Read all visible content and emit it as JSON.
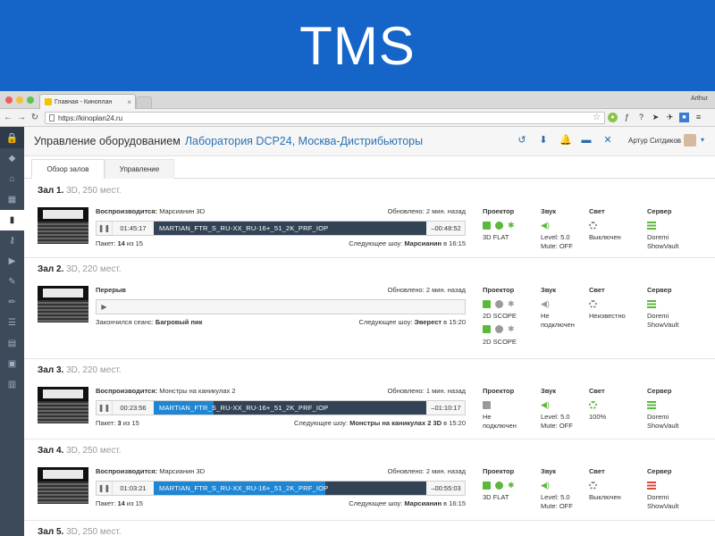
{
  "banner": {
    "title": "TMS"
  },
  "browser": {
    "tab_title": "Главная - Киноплан",
    "user": "Arthur",
    "url": "https://kinoplan24.ru"
  },
  "header": {
    "title": "Управление оборудованием",
    "org_link": "Лаборатория DCP24, Москва-Дистрибьюторы",
    "user_name": "Артур Ситдиков"
  },
  "tabs": {
    "overview": "Обзор залов",
    "control": "Управление"
  },
  "labels": {
    "projector": "Проектор",
    "sound": "Звук",
    "light": "Свет",
    "server": "Сервер"
  },
  "halls": [
    {
      "name": "Зал 1.",
      "meta": "3D, 250 мест.",
      "status_prefix": "Воспроизводится:",
      "status_title": "Марсианин 3D",
      "updated": "Обновлено: 2 мин. назад",
      "elapsed": "01:45:17",
      "track": "MARTIAN_FTR_S_RU-XX_RU-16+_51_2K_PRF_IOP",
      "progress": 0.0,
      "remaining": "–00:48:52",
      "package_prefix": "Пакет:",
      "package_num": "14",
      "package_of": "из 15",
      "next_prefix": "Следующее шоу:",
      "next_title": "Марсианин",
      "next_time": "в 16:15",
      "projector_text": "3D FLAT",
      "sound_text": "Level: 5.0\nMute: OFF",
      "light_text": "Выключен",
      "server_text": "Doremi\nShowVault"
    },
    {
      "name": "Зал 2.",
      "meta": "3D, 220 мест.",
      "status_title": "Перерыв",
      "updated": "Обновлено: 2 мин. назад",
      "ended_prefix": "Закончился сеанс:",
      "ended_title": "Багровый пик",
      "next_prefix": "Следующее шоу:",
      "next_title": "Эверест",
      "next_time": "в 15:20",
      "projector_text_1": "2D SCOPE",
      "projector_text_2": "2D SCOPE",
      "sound_text": "Не\nподключен",
      "light_text": "Неизвестно",
      "server_text": "Doremi\nShowVault"
    },
    {
      "name": "Зал 3.",
      "meta": "3D, 220 мест.",
      "status_prefix": "Воспроизводится:",
      "status_title": "Монстры на каникулах 2",
      "updated": "Обновлено: 1 мин. назад",
      "elapsed": "00:23:56",
      "track": "MARTIAN_FTR_S_RU-XX_RU-16+_51_2K_PRF_IOP",
      "progress": 0.22,
      "remaining": "–01:10:17",
      "package_prefix": "Пакет:",
      "package_num": "3",
      "package_of": "из 15",
      "next_prefix": "Следующее шоу:",
      "next_title": "Монстры на каникулах 2 3D",
      "next_time": "в 15:20",
      "projector_text": "Не\nподключен",
      "sound_text": "Level: 5.0\nMute: OFF",
      "light_text": "100%",
      "server_text": "Doremi\nShowVault"
    },
    {
      "name": "Зал 4.",
      "meta": "3D, 250 мест.",
      "status_prefix": "Воспроизводится:",
      "status_title": "Марсианин 3D",
      "updated": "Обновлено: 2 мин. назад",
      "elapsed": "01:03:21",
      "track": "MARTIAN_FTR_S_RU-XX_RU-16+_51_2K_PRF_IOP",
      "progress": 0.63,
      "remaining": "–00:55:03",
      "package_prefix": "Пакет:",
      "package_num": "14",
      "package_of": "из 15",
      "next_prefix": "Следующее шоу:",
      "next_title": "Марсианин",
      "next_time": "в 16:15",
      "projector_text": "3D FLAT",
      "sound_text": "Level: 5.0\nMute: OFF",
      "light_text": "Выключен",
      "server_text": "Doremi\nShowVault"
    },
    {
      "name": "Зал 5.",
      "meta": "3D, 250 мест."
    }
  ]
}
